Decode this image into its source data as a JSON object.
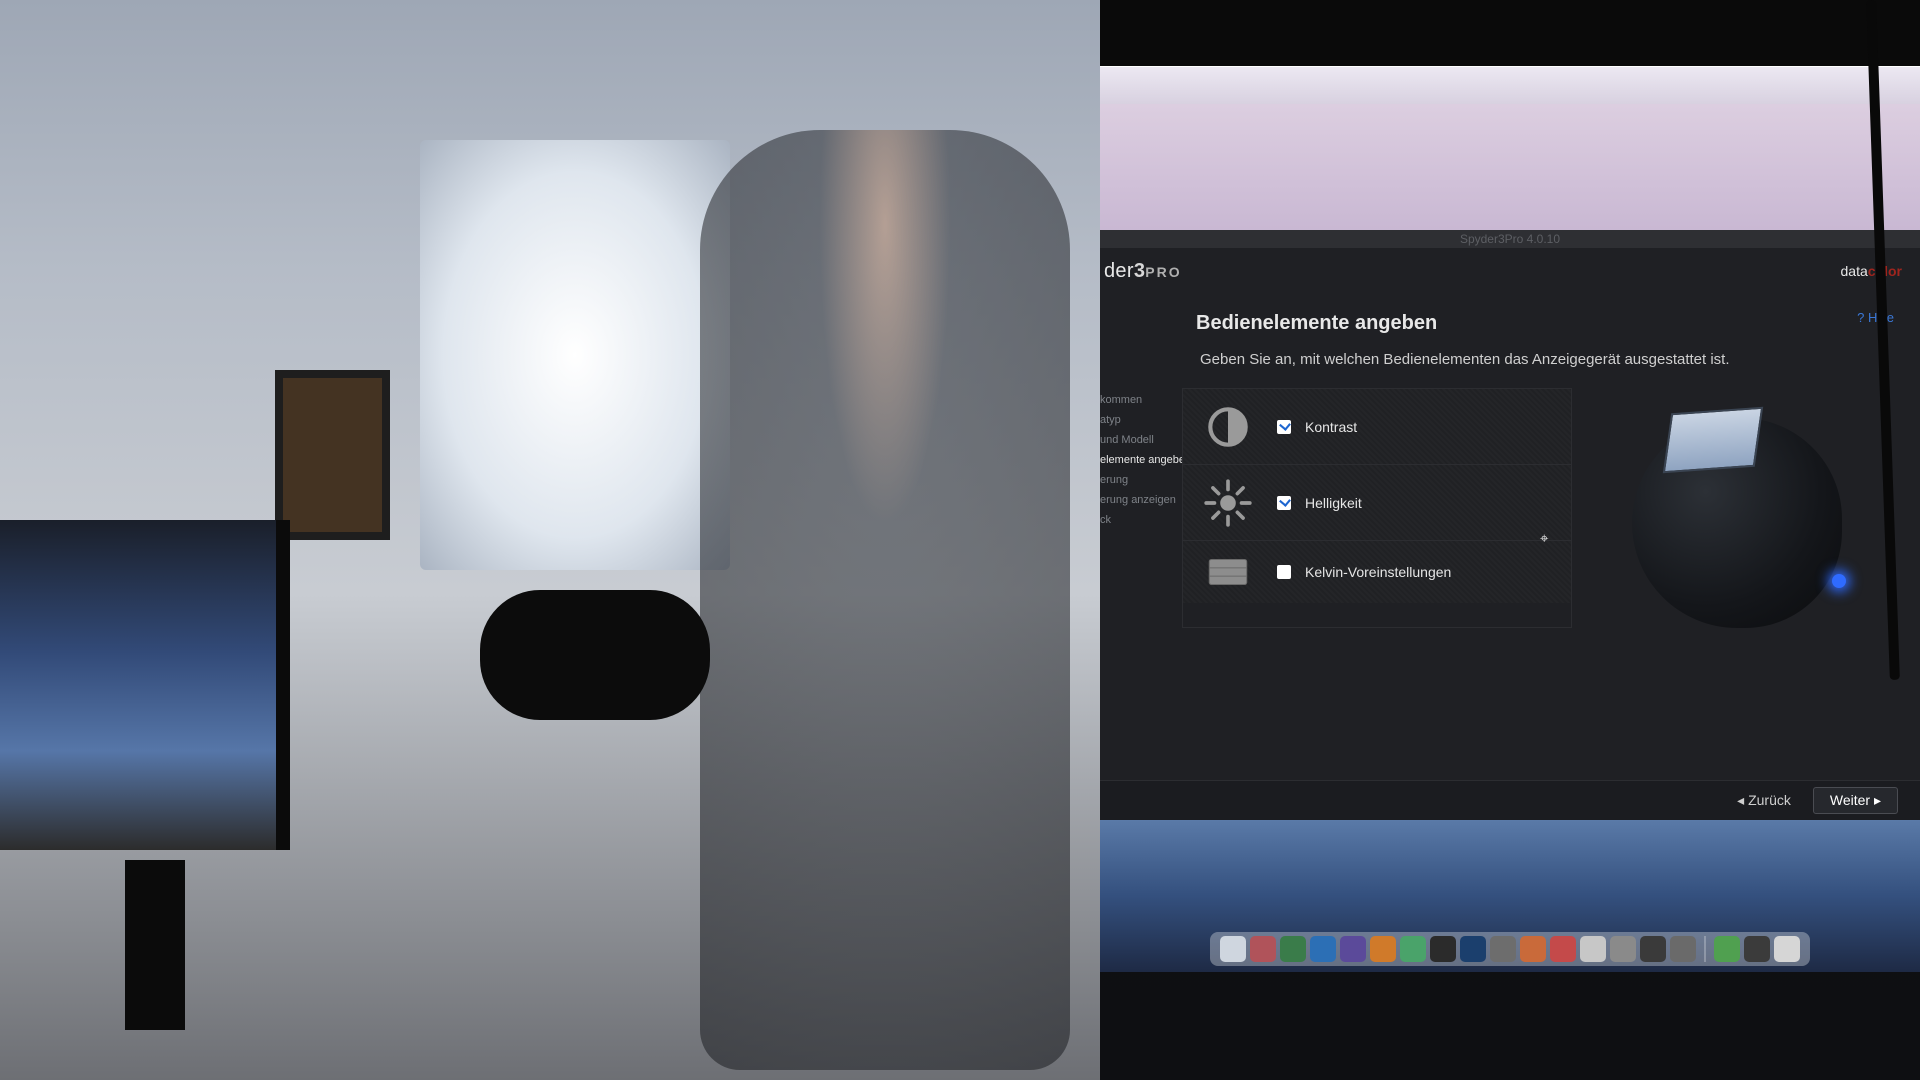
{
  "app": {
    "window_title": "Spyder3Pro 4.0.10",
    "brand_prefix": "der",
    "brand_number": "3",
    "brand_suffix": "PRO",
    "company_part1": "data",
    "company_part2": "color",
    "help_label": "? Hilfe"
  },
  "page": {
    "title": "Bedienelemente angeben",
    "instructions": "Geben Sie an, mit welchen Bedienelementen das Anzeigegerät ausgestattet ist."
  },
  "sidenav": {
    "items": [
      "kommen",
      "atyp",
      "und Modell",
      "elemente angeben",
      "erung",
      "erung anzeigen",
      "ck"
    ],
    "active_index": 3
  },
  "options": {
    "contrast": {
      "label": "Kontrast",
      "checked": true
    },
    "brightness": {
      "label": "Helligkeit",
      "checked": true
    },
    "kelvin": {
      "label": "Kelvin-Voreinstellungen",
      "checked": false
    }
  },
  "footer": {
    "back": "Zurück",
    "next": "Weiter"
  },
  "dock_colors": [
    "#cfd6df",
    "#b0535a",
    "#3a7c4a",
    "#2c6fb5",
    "#5b4a9a",
    "#d07a2a",
    "#4aa36a",
    "#2b2b2b",
    "#1b3f6d",
    "#6d6d6d",
    "#c96a3a",
    "#c44a4a",
    "#c7c7c7",
    "#8a8a8a",
    "#3a3a3a",
    "#6a6a6a",
    "#50a050",
    "#3b3b3b",
    "#d6d6d6"
  ]
}
